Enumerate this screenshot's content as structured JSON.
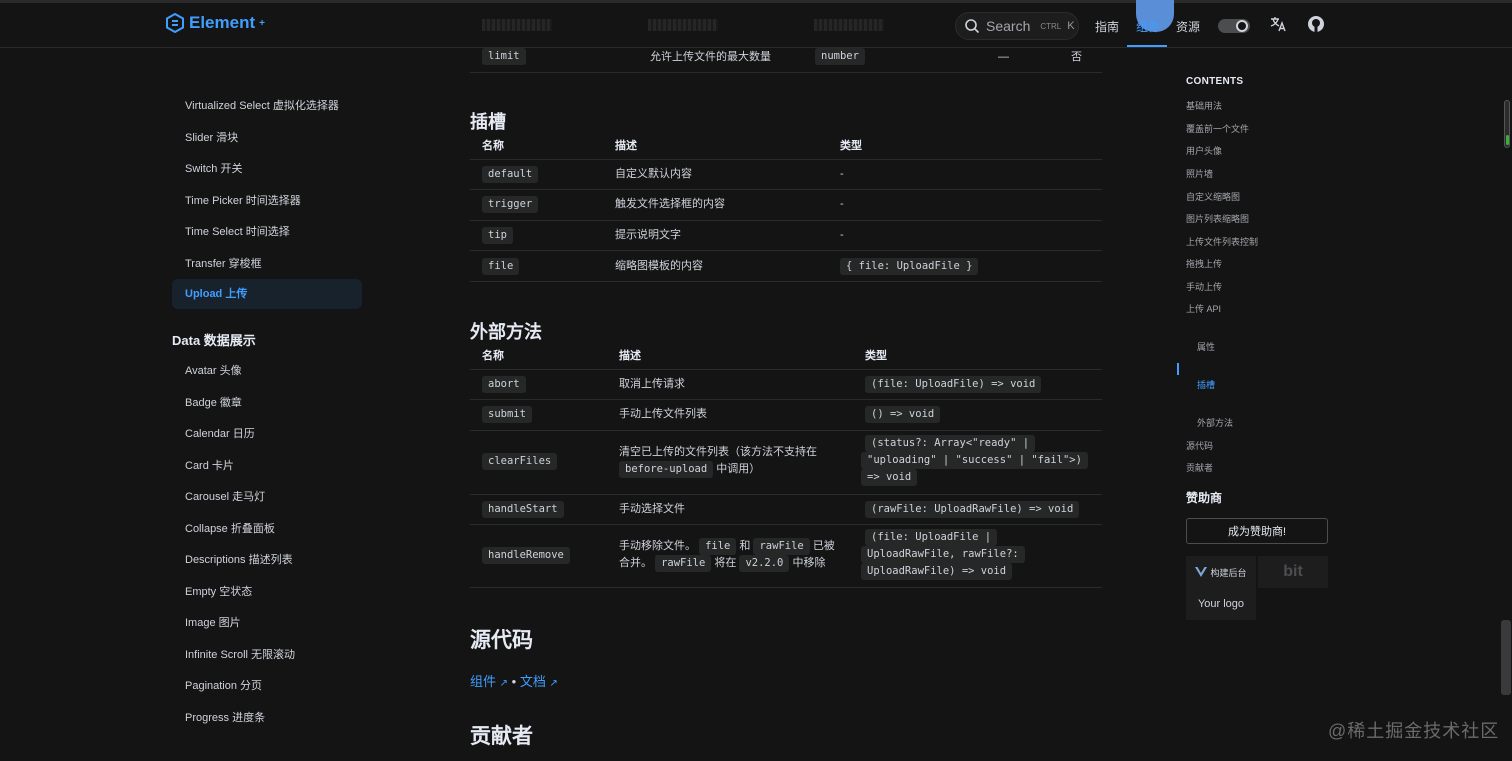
{
  "app": {
    "logo_text": "Element",
    "logo_sup": "+"
  },
  "navbar": {
    "search_label": "Search",
    "search_kbd_ctrl": "CTRL",
    "search_kbd_k": "K",
    "links": [
      "指南",
      "组件",
      "资源"
    ],
    "active_link": "组件",
    "translate_icon": "translate-icon",
    "github_icon": "github-icon"
  },
  "sidebar": {
    "items_top": [
      "Virtualized Select 虚拟化选择器",
      "Slider 滑块",
      "Switch 开关",
      "Time Picker 时间选择器",
      "Time Select 时间选择",
      "Transfer 穿梭框",
      "Upload 上传"
    ],
    "group_title": "Data 数据展示",
    "items_data": [
      "Avatar 头像",
      "Badge 徽章",
      "Calendar 日历",
      "Card 卡片",
      "Carousel 走马灯",
      "Collapse 折叠面板",
      "Descriptions 描述列表",
      "Empty 空状态",
      "Image 图片",
      "Infinite Scroll 无限滚动",
      "Pagination 分页",
      "Progress 进度条"
    ]
  },
  "main": {
    "attr_row": {
      "name": "limit",
      "desc": "允许上传文件的最大数量",
      "type": "number",
      "default": "—",
      "required": "否"
    },
    "slots": {
      "title": "插槽",
      "headers": [
        "名称",
        "描述",
        "类型"
      ],
      "rows": [
        {
          "name": "default",
          "desc": "自定义默认内容",
          "type": "-"
        },
        {
          "name": "trigger",
          "desc": "触发文件选择框的内容",
          "type": "-"
        },
        {
          "name": "tip",
          "desc": "提示说明文字",
          "type": "-"
        },
        {
          "name": "file",
          "desc": "缩略图模板的内容",
          "type": "{ file: UploadFile }"
        }
      ]
    },
    "methods": {
      "title": "外部方法",
      "headers": [
        "名称",
        "描述",
        "类型"
      ],
      "rows": [
        {
          "name": "abort",
          "desc": "取消上传请求",
          "type": "(file: UploadFile) => void"
        },
        {
          "name": "submit",
          "desc": "手动上传文件列表",
          "type": "() => void"
        },
        {
          "name": "clearFiles",
          "desc_a": "清空已上传的文件列表（该方法不支持在",
          "desc_code": "before-upload",
          "desc_b": "中调用）",
          "type_l1": "(status?: Array<\"ready\" |",
          "type_l2": "\"uploading\" | \"success\" | \"fail\">)",
          "type_l3": "=> void"
        },
        {
          "name": "handleStart",
          "desc": "手动选择文件",
          "type": "(rawFile: UploadRawFile) => void"
        },
        {
          "name": "handleRemove",
          "desc_a": "手动移除文件。",
          "desc_code1": "file",
          "desc_and": "和",
          "desc_code2": "rawFile",
          "desc_b": "已被",
          "desc_c": "合并。",
          "desc_code3": "rawFile",
          "desc_d": "将在",
          "desc_code4": "v2.2.0",
          "desc_e": "中移除",
          "type_l1": "(file: UploadFile |",
          "type_l2": "UploadRawFile, rawFile?:",
          "type_l3": "UploadRawFile) => void"
        }
      ]
    },
    "source": {
      "title": "源代码",
      "link1": "组件",
      "sep": "•",
      "link2": "文档"
    },
    "contributors_title": "贡献者"
  },
  "toc": {
    "title": "CONTENTS",
    "items": [
      "基础用法",
      "覆盖前一个文件",
      "用户头像",
      "照片墙",
      "自定义缩略图",
      "图片列表缩略图",
      "上传文件列表控制",
      "拖拽上传",
      "手动上传",
      "上传 API"
    ],
    "sub_items": [
      "属性",
      "插槽",
      "外部方法"
    ],
    "active": "插槽",
    "tail_items": [
      "源代码",
      "贡献者"
    ],
    "sponsor_title": "赞助商",
    "sponsor_button": "成为赞助商!",
    "sponsor_card1": "构建后台",
    "sponsor_card2": "bit",
    "sponsor_card3": "Your logo"
  },
  "watermark": "@稀土掘金技术社区",
  "colors": {
    "accent": "#409eff",
    "background": "#141414"
  }
}
